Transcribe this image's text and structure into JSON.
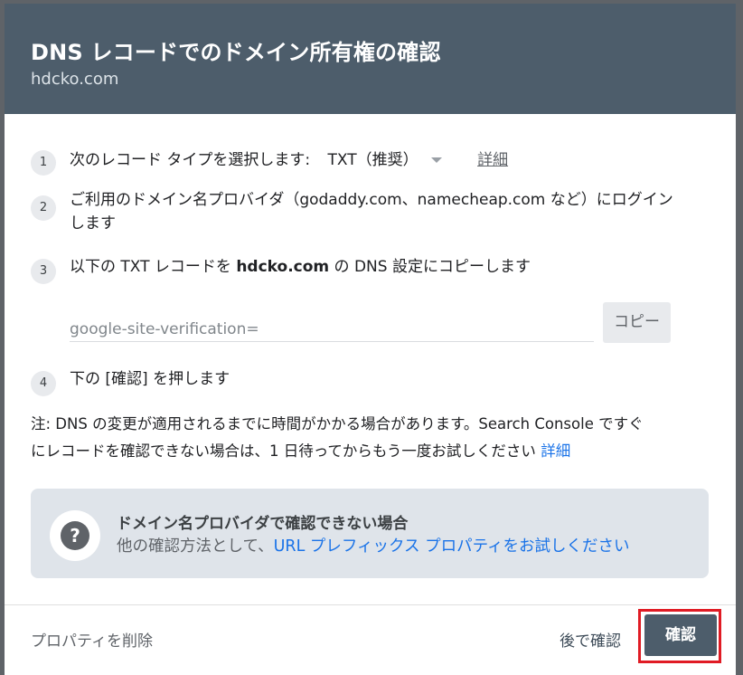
{
  "dialog": {
    "title": "DNS レコードでのドメイン所有権の確認",
    "subtitle": "hdcko.com"
  },
  "steps": [
    {
      "number": "1",
      "text": "次のレコード タイプを選択します:",
      "select_value": "TXT（推奨）",
      "link": "詳細"
    },
    {
      "number": "2",
      "line1": "ご利用のドメイン名プロバイダ（godaddy.com、namecheap.com など）にログイン",
      "line2": "します"
    },
    {
      "number": "3",
      "prefix": "以下の TXT レコードを ",
      "domain": "hdcko.com",
      "suffix": " の DNS 設定にコピーします"
    },
    {
      "number": "4",
      "text": "下の [確認] を押します"
    }
  ],
  "txt_record": {
    "value": "google-site-verification=",
    "copy_label": "コピー"
  },
  "note": {
    "line1": "注: DNS の変更が適用されるまでに時間がかかる場合があります。Search Console ですぐ",
    "line2": "にレコードを確認できない場合は、1 日待ってからもう一度お試しください",
    "link": "詳細"
  },
  "info_box": {
    "title": "ドメイン名プロバイダで確認できない場合",
    "text_prefix": "他の確認方法として、",
    "link": "URL プレフィックス プロパティをお試しください",
    "icon": "help-icon"
  },
  "footer": {
    "delete_label": "プロパティを削除",
    "later_label": "後で確認",
    "confirm_label": "確認"
  },
  "colors": {
    "header": "#4d5d6b",
    "link": "#1a73e8",
    "highlight": "#e01b24"
  }
}
